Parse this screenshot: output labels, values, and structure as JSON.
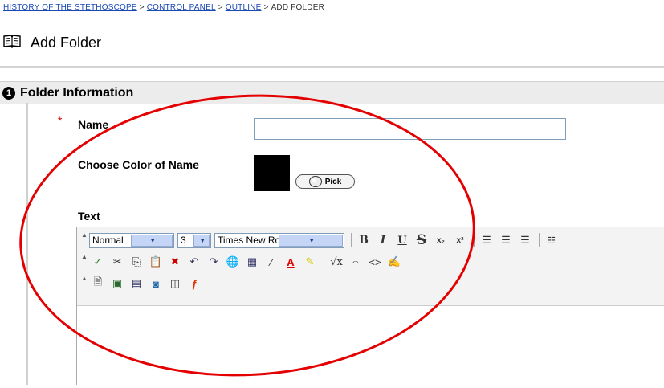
{
  "breadcrumb": {
    "course": "HISTORY OF THE STETHOSCOPE",
    "control_panel": "CONTROL PANEL",
    "outline": "OUTLINE",
    "current": "ADD FOLDER",
    "separator": ">"
  },
  "page": {
    "title": "Add Folder",
    "icon": "book-icon"
  },
  "section": {
    "number": "1",
    "title": "Folder Information"
  },
  "form": {
    "required_marker": "*",
    "name_label": "Name",
    "name_value": "",
    "color_label": "Choose Color of Name",
    "color_value": "#000000",
    "pick_label": "Pick",
    "text_label": "Text"
  },
  "toolbar": {
    "format_value": "Normal",
    "size_value": "3",
    "font_value": "Times New Roman",
    "bold": "B",
    "italic": "I",
    "underline": "U",
    "strike": "S",
    "subscript": "x₂",
    "superscript": "x²"
  },
  "colors": {
    "link": "#1a49b4",
    "annotation": "#e40000",
    "required": "#dd0000"
  }
}
